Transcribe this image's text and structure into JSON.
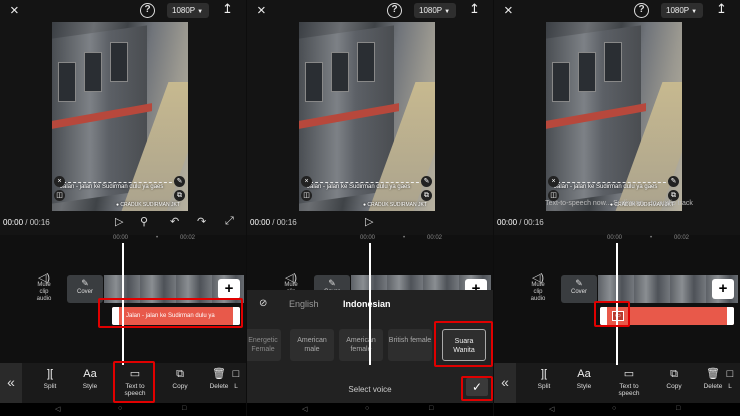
{
  "top_bar": {
    "resolution": "1080P",
    "close_icon": "×",
    "help_icon": "?",
    "export_icon": "↥"
  },
  "video": {
    "caption": "Jalan - jalan ke Sudirman dulu ya gaes",
    "watermark": "● CRADUK SUDIRMAN JKT",
    "edit_icon": "✎",
    "copy_icon": "⧉",
    "remove_icon": "×",
    "audio_icon": "◫"
  },
  "playback": {
    "current": "00:00",
    "separator": "/",
    "total": "00:16"
  },
  "timeline": {
    "ruler_0": "00:00",
    "ruler_dot": "•",
    "ruler_1": "00:02",
    "mute_label": "Mute clip audio",
    "cover_label": "Cover",
    "text_clip": "Jalan - jalan ke Sudirman dulu ya",
    "add_button": "+"
  },
  "toolbar": {
    "back": "«",
    "split": "Split",
    "style": "Style",
    "tts": "Text to speech",
    "copy": "Copy",
    "delete": "Delete",
    "cut": "L"
  },
  "voice_sheet": {
    "tab_english": "English",
    "tab_indonesian": "Indonesian",
    "voices": [
      "Energetic Female",
      "American male",
      "American female",
      "British female",
      "Suara Wanita"
    ],
    "title": "Select voice",
    "confirm": "✓"
  },
  "panel3": {
    "ghost_text": "Text-to-speech now... Sudirman... to audio track"
  },
  "colors": {
    "accent_red": "#e00000",
    "text_clip": "#e8594a"
  }
}
